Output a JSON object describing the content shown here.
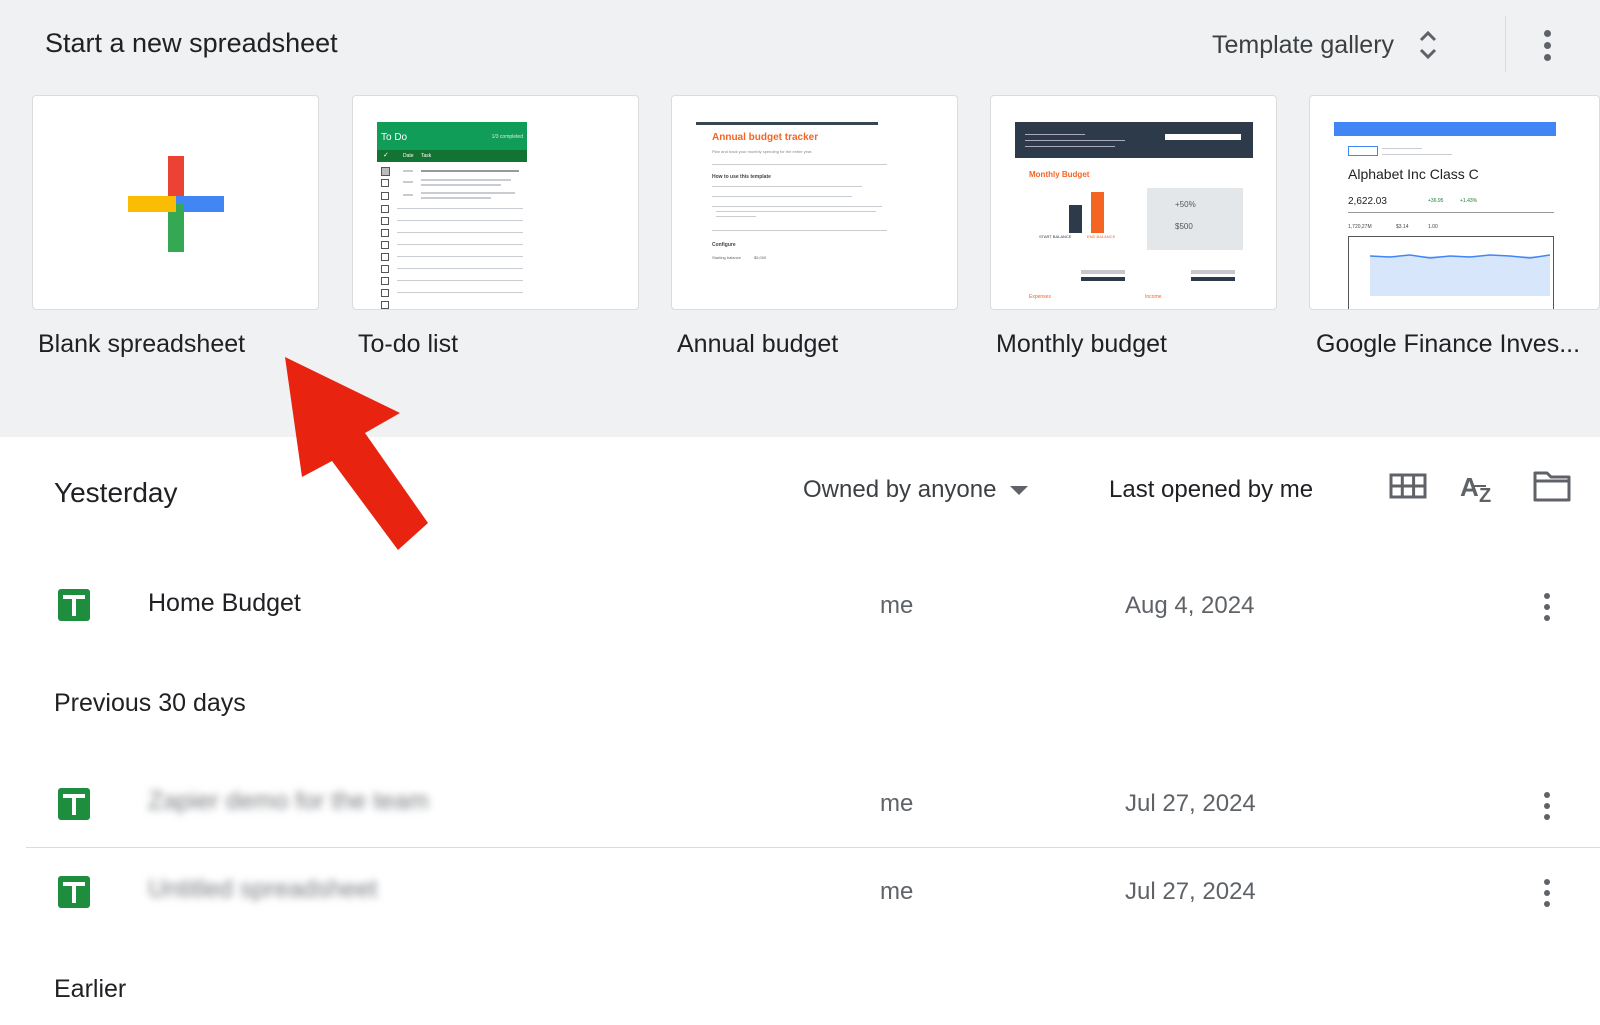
{
  "templates": {
    "title": "Start a new spreadsheet",
    "gallery_label": "Template gallery",
    "items": [
      {
        "label": "Blank spreadsheet"
      },
      {
        "label": "To-do list",
        "thumb_title": "To Do",
        "thumb_sub": "1/3 completed",
        "col_date": "Date",
        "col_task": "Task"
      },
      {
        "label": "Annual budget",
        "thumb_title": "Annual budget tracker",
        "thumb_sub": "Plan and track your monthly spending for the entire year.",
        "how_to": "How to use this template",
        "configure": "Configure",
        "starting": "Starting balance",
        "starting_val": "$5,000"
      },
      {
        "label": "Monthly budget",
        "thumb_title": "Monthly Budget",
        "start_label": "START BALANCE",
        "end_label": "END BALANCE",
        "pct": "+50%",
        "amount": "$500",
        "expenses": "Expenses",
        "income": "Income"
      },
      {
        "label": "Google Finance Inves...",
        "company": "Alphabet Inc Class C",
        "price": "2,622.03",
        "change": "+36.95",
        "change_pct": "+1.43%",
        "market_cap": "1,720,27M",
        "pe": "$3.14",
        "beta": "1.00"
      }
    ]
  },
  "files": {
    "owned_filter": "Owned by anyone",
    "sort_label": "Last opened by me",
    "sections": [
      {
        "label": "Yesterday"
      },
      {
        "label": "Previous 30 days"
      },
      {
        "label": "Earlier"
      }
    ],
    "rows": [
      {
        "name": "Home Budget",
        "owner": "me",
        "date": "Aug 4, 2024"
      },
      {
        "name": "Zapier demo for the team",
        "owner": "me",
        "date": "Jul 27, 2024"
      },
      {
        "name": "Untitled spreadsheet",
        "owner": "me",
        "date": "Jul 27, 2024"
      }
    ]
  },
  "colors": {
    "sheets_green": "#1e8e3e",
    "arrow_red": "#e8230f",
    "accent_orange": "#f46524",
    "finance_blue": "#4285f4"
  }
}
